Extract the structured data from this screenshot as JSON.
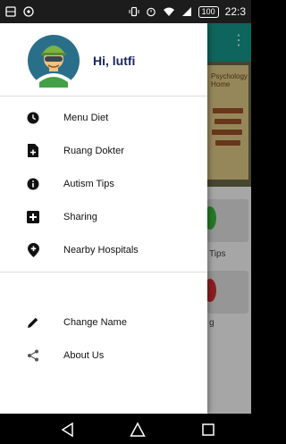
{
  "status_bar": {
    "battery": "100",
    "time": "22:3"
  },
  "drawer": {
    "greeting": "Hi, lutfi",
    "main_items": [
      {
        "label": "Menu Diet",
        "icon": "clock-icon"
      },
      {
        "label": "Ruang Dokter",
        "icon": "file-plus-icon"
      },
      {
        "label": "Autism Tips",
        "icon": "info-icon"
      },
      {
        "label": "Sharing",
        "icon": "plus-square-icon"
      },
      {
        "label": "Nearby Hospitals",
        "icon": "location-plus-icon"
      }
    ],
    "secondary_items": [
      {
        "label": "Change Name",
        "icon": "pencil-icon"
      },
      {
        "label": "About Us",
        "icon": "share-icon"
      }
    ]
  },
  "background_app": {
    "banner_title": "Psychology Home",
    "tile_labels": [
      "Tips",
      "g"
    ]
  },
  "colors": {
    "accent": "#169b8f",
    "greeting": "#1b2566",
    "tile_green": "#3dbb3d",
    "tile_red": "#d93030"
  }
}
